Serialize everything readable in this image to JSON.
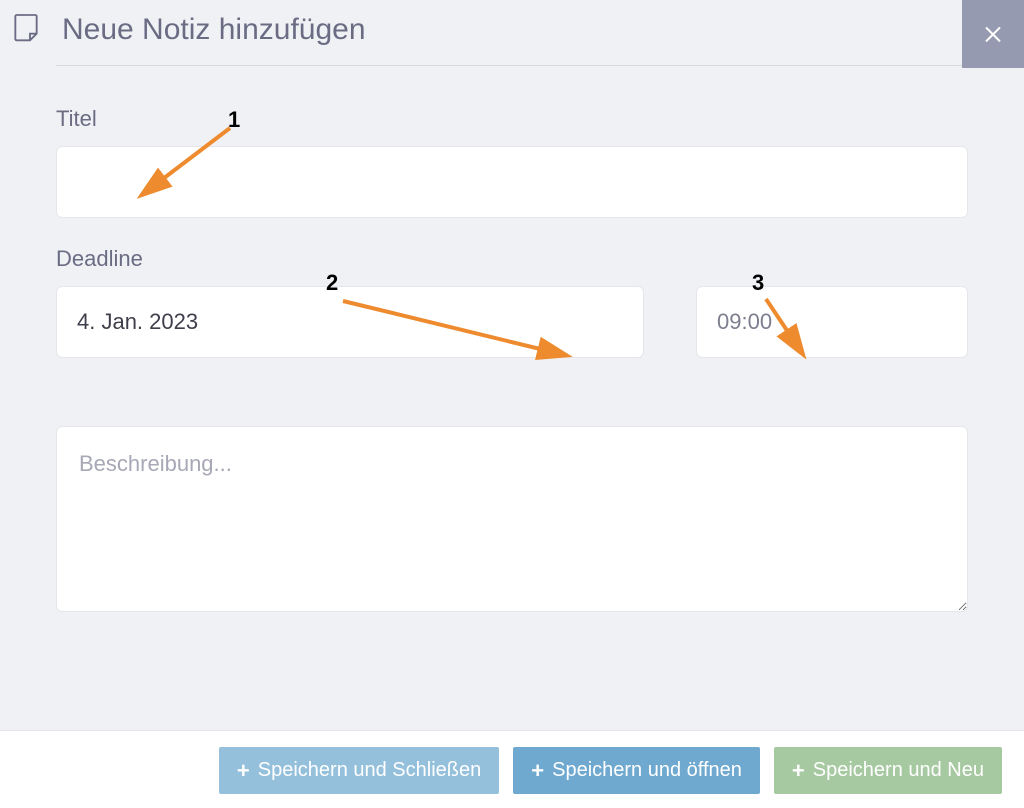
{
  "header": {
    "title": "Neue Notiz hinzufügen"
  },
  "form": {
    "title_label": "Titel",
    "title_value": "",
    "deadline_label": "Deadline",
    "deadline_date": "4. Jan. 2023",
    "deadline_time": "09:00",
    "description_placeholder": "Beschreibung..."
  },
  "buttons": {
    "save_close": "Speichern und Schließen",
    "save_open": "Speichern und öffnen",
    "save_new": "Speichern und Neu"
  },
  "annotations": {
    "a1": "1",
    "a2": "2",
    "a3": "3"
  }
}
